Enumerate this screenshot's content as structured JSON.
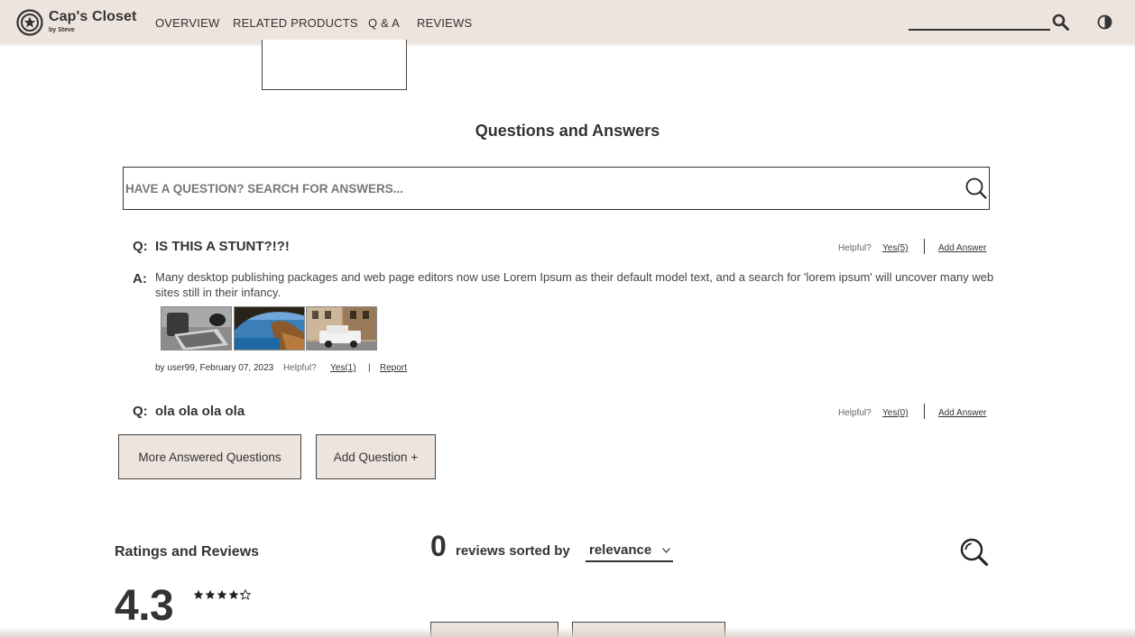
{
  "navbar": {
    "brand": "Cap's Closet",
    "brand_sub": "by Steve",
    "links": [
      "OVERVIEW",
      "RELATED PRODUCTS",
      "Q & A",
      "REVIEWS"
    ]
  },
  "qa": {
    "title": "Questions and Answers",
    "search_placeholder": "HAVE A QUESTION? SEARCH FOR ANSWERS...",
    "q_prefix": "Q:",
    "a_prefix": "A:",
    "helpful_label": "Helpful?",
    "add_answer_label": "Add Answer",
    "questions": [
      {
        "text": "IS THIS A STUNT?!?!",
        "yes_label": "Yes(5)",
        "answers": [
          {
            "text": "Many desktop publishing packages and web page editors now use Lorem Ipsum as their default model text, and a search for 'lorem ipsum' will uncover many web sites still in their infancy.",
            "meta": "by user99, February 07, 2023",
            "helpful_label": "Helpful?",
            "yes_label": "Yes(1)",
            "separator": "|",
            "report_label": "Report"
          }
        ]
      },
      {
        "text": "ola ola ola ola",
        "yes_label": "Yes(0)"
      }
    ],
    "more_button": "More Answered Questions",
    "add_question_button": "Add Question +"
  },
  "ratings": {
    "title": "Ratings and Reviews",
    "average": "4.3",
    "stars": 4.3,
    "review_count": "0",
    "sorted_by_label": "reviews sorted by",
    "sort_value": "relevance"
  },
  "colors": {
    "navbar_bg": "#eee4de",
    "button_bg": "#eee4de",
    "text": "#333333"
  },
  "icons": [
    "logo-star-icon",
    "search-icon",
    "moon-icon",
    "chevron-down-icon",
    "star-icon"
  ]
}
